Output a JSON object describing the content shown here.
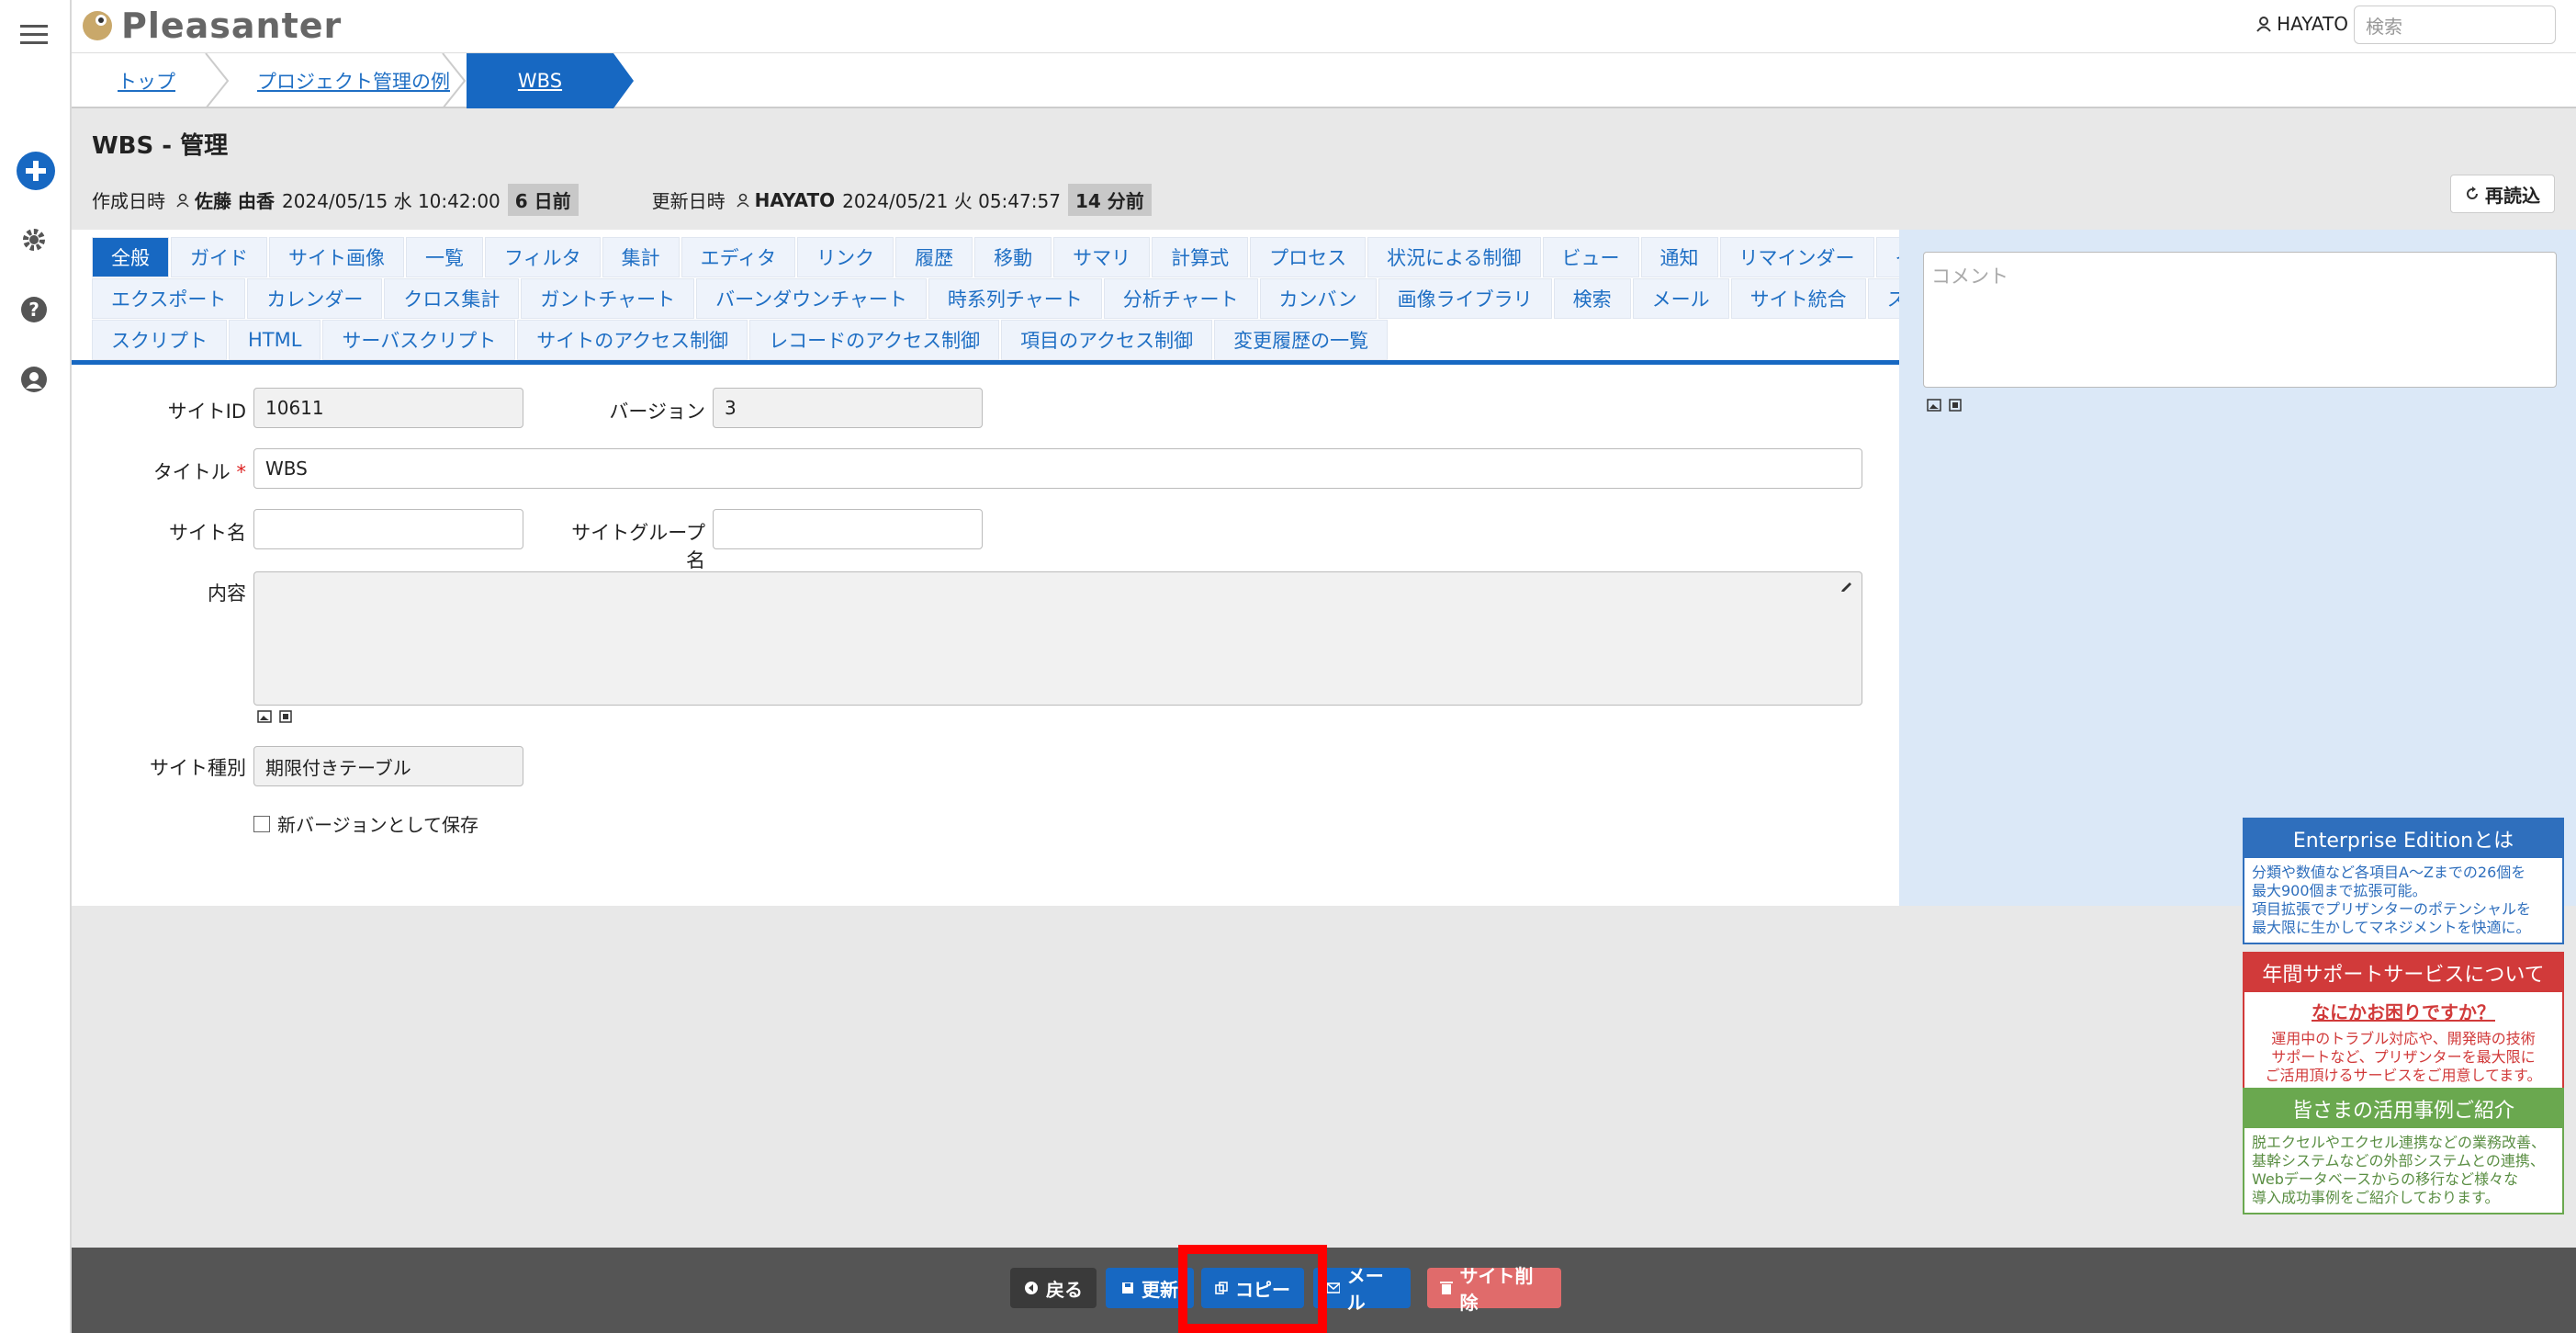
{
  "header": {
    "app_name": "Pleasanter",
    "user": "HAYATO",
    "search_placeholder": "検索"
  },
  "breadcrumb": [
    "トップ",
    "プロジェクト管理の例",
    "WBS"
  ],
  "page": {
    "title": "WBS - 管理",
    "created_label": "作成日時",
    "created_by": "佐藤 由香",
    "created_at": "2024/05/15 水 10:42:00",
    "created_ago": "6 日前",
    "updated_label": "更新日時",
    "updated_by": "HAYATO",
    "updated_at": "2024/05/21 火 05:47:57",
    "updated_ago": "14 分前",
    "reload_label": "再読込"
  },
  "tabs": {
    "row1": [
      "全般",
      "ガイド",
      "サイト画像",
      "一覧",
      "フィルタ",
      "集計",
      "エディタ",
      "リンク",
      "履歴",
      "移動",
      "サマリ",
      "計算式",
      "プロセス",
      "状況による制御",
      "ビュー",
      "通知",
      "リマインダー",
      "インポート"
    ],
    "row2": [
      "エクスポート",
      "カレンダー",
      "クロス集計",
      "ガントチャート",
      "バーンダウンチャート",
      "時系列チャート",
      "分析チャート",
      "カンバン",
      "画像ライブラリ",
      "検索",
      "メール",
      "サイト統合",
      "スタイル"
    ],
    "row3": [
      "スクリプト",
      "HTML",
      "サーバスクリプト",
      "サイトのアクセス制御",
      "レコードのアクセス制御",
      "項目のアクセス制御",
      "変更履歴の一覧"
    ]
  },
  "form": {
    "site_id_label": "サイトID",
    "site_id": "10611",
    "version_label": "バージョン",
    "version": "3",
    "title_label": "タイトル",
    "required_mark": "*",
    "title_value": "WBS",
    "site_name_label": "サイト名",
    "site_name": "",
    "site_group_label": "サイトグループ名",
    "site_group": "",
    "content_label": "内容",
    "site_type_label": "サイト種別",
    "site_type": "期限付きテーブル",
    "new_version_label": "新バージョンとして保存"
  },
  "comment_placeholder": "コメント",
  "ads": [
    {
      "title": "Enterprise Editionとは",
      "lines": [
        "分類や数値など各項目A～Zまでの26個を",
        "最大900個まで拡張可能。",
        "項目拡張でプリザンターのポテンシャルを",
        "最大限に生かしてマネジメントを快適に。"
      ],
      "color": "#2f6fbd"
    },
    {
      "title": "年間サポートサービスについて",
      "subtitle": "なにかお困りですか？",
      "lines": [
        "運用中のトラブル対応や、開発時の技術",
        "サポートなど、プリザンターを最大限に",
        "ご活用頂けるサービスをご用意してます。"
      ],
      "color": "#d13a3a"
    },
    {
      "title": "皆さまの活用事例ご紹介",
      "lines": [
        "脱エクセルやエクセル連携などの業務改善、",
        "基幹システムなどの外部システムとの連携、",
        "Webデータベースからの移行など様々な",
        "導入成功事例をご紹介しております。"
      ],
      "color": "#6aa84f"
    }
  ],
  "footer": {
    "back": "戻る",
    "update": "更新",
    "copy": "コピー",
    "mail": "メール",
    "delete": "サイト削除"
  }
}
